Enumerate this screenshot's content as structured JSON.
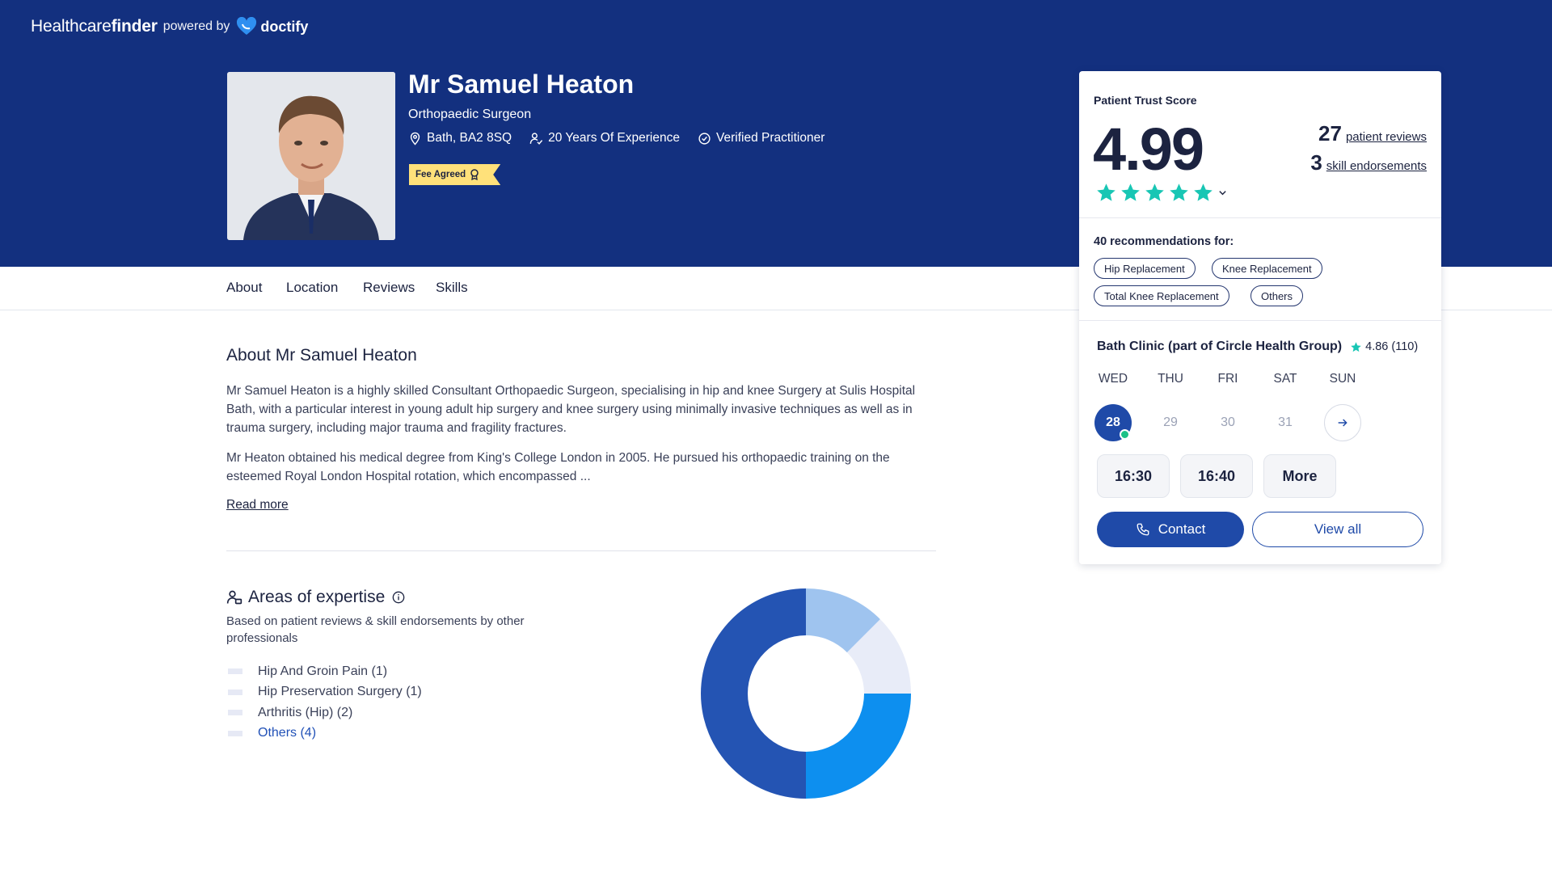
{
  "brand": {
    "name_part1": "Healthcare",
    "name_part2": "finder",
    "powered_by": "powered by",
    "partner": "doctify"
  },
  "doctor": {
    "name": "Mr Samuel Heaton",
    "specialty": "Orthopaedic Surgeon",
    "location": "Bath, BA2 8SQ",
    "experience": "20 Years Of Experience",
    "verified": "Verified Practitioner",
    "fee_badge": "Fee Agreed"
  },
  "tabs": [
    "About",
    "Location",
    "Reviews",
    "Skills"
  ],
  "about": {
    "title": "About Mr Samuel Heaton",
    "paragraph1": "Mr Samuel Heaton is a highly skilled Consultant Orthopaedic Surgeon, specialising in hip and knee Surgery at Sulis Hospital Bath, with a particular interest in young adult hip surgery and knee surgery using minimally invasive techniques as well as in trauma surgery, including major trauma and fragility fractures.",
    "paragraph2": "Mr Heaton obtained his medical degree from King's College London in 2005. He pursued his orthopaedic training on the esteemed Royal London Hospital rotation, which encompassed ...",
    "read_more": "Read more"
  },
  "expertise": {
    "title": "Areas of expertise",
    "subtitle": "Based on patient reviews & skill endorsements by other professionals",
    "items": [
      {
        "label": "Hip And Groin Pain (1)"
      },
      {
        "label": "Hip Preservation Surgery (1)"
      },
      {
        "label": "Arthritis (Hip) (2)"
      },
      {
        "label": "Others (4)"
      }
    ]
  },
  "chart_data": {
    "type": "pie",
    "categories": [
      "Hip And Groin Pain",
      "Hip Preservation Surgery",
      "Arthritis (Hip)",
      "Others"
    ],
    "values": [
      1,
      1,
      2,
      4
    ],
    "colors": [
      "#9fc4ef",
      "#e8ecf8",
      "#0d8fef",
      "#2454b3"
    ]
  },
  "trust": {
    "label": "Patient Trust Score",
    "score": "4.99",
    "stars": 5,
    "reviews_count": "27",
    "reviews_label": "patient reviews",
    "endorsements_count": "3",
    "endorsements_label": "skill endorsements",
    "recommendations_label": "40 recommendations for:",
    "recommendation_chips": [
      "Hip Replacement",
      "Knee Replacement",
      "Total Knee Replacement",
      "Others"
    ]
  },
  "booking": {
    "clinic": "Bath Clinic (part of Circle Health Group)",
    "clinic_rating": "4.86 (110)",
    "days": [
      "WED",
      "THU",
      "FRI",
      "SAT",
      "SUN"
    ],
    "dates": [
      "28",
      "29",
      "30",
      "31"
    ],
    "selected_date": "28",
    "slots": [
      "16:30",
      "16:40",
      "More"
    ],
    "contact_label": "Contact",
    "view_all_label": "View all"
  },
  "colors": {
    "hero": "#13307f",
    "primary": "#1f4aa8",
    "star": "#18c6b4",
    "available": "#1bc088",
    "badge": "#ffe17a"
  }
}
